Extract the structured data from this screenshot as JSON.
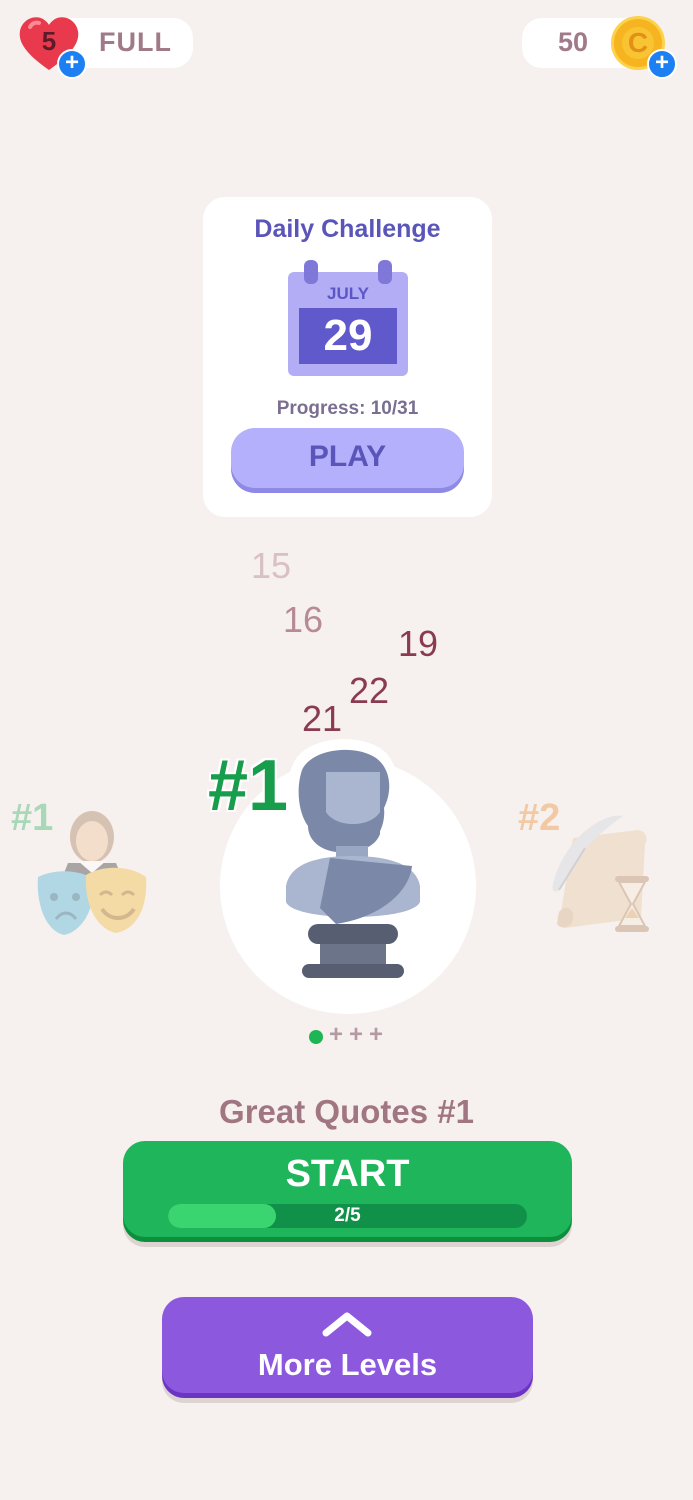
{
  "header": {
    "lives_count": "5",
    "lives_status": "FULL",
    "coins": "50",
    "add_symbol": "+"
  },
  "daily": {
    "title": "Daily Challenge",
    "month": "JULY",
    "day": "29",
    "progress": "Progress: 10/31",
    "play_label": "PLAY"
  },
  "map_numbers": [
    {
      "label": "15",
      "color": "#d9bfc6"
    },
    {
      "label": "16",
      "color": "#b78a97"
    },
    {
      "label": "19",
      "color": "#8a3b53"
    },
    {
      "label": "22",
      "color": "#8a3b53"
    },
    {
      "label": "21",
      "color": "#8a3b53"
    }
  ],
  "packs": {
    "current_rank": "#1",
    "left_rank": "#1",
    "right_rank": "#2",
    "left_icon": "theater-masks-icon",
    "current_icon": "statue-bust-icon",
    "right_icon": "quill-scroll-icon",
    "page_dots": [
      "+",
      "+",
      "+"
    ]
  },
  "level": {
    "title": "Great Quotes #1",
    "start_label": "START",
    "progress_text": "2/5",
    "progress_fraction": 0.3
  },
  "more_levels": {
    "label": "More Levels",
    "icon": "chevron-up-icon"
  },
  "colors": {
    "background": "#f6f1ef",
    "green": "#1fb55a",
    "purple": "#8c58de",
    "lavender": "#b5b0fb"
  }
}
